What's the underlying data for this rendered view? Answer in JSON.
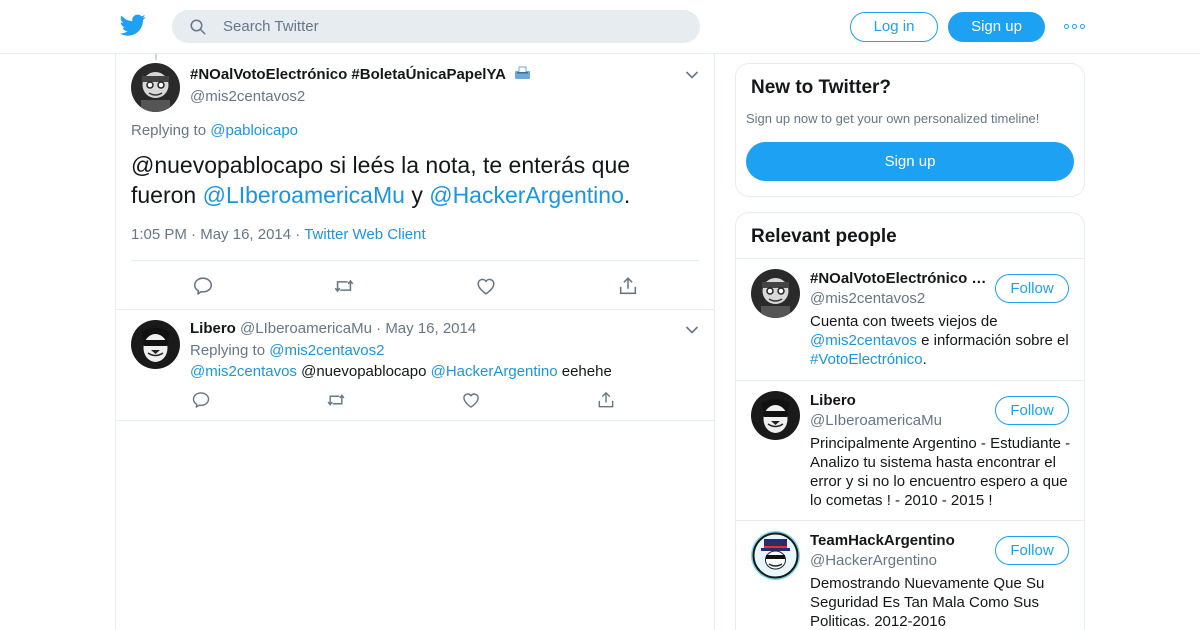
{
  "topbar": {
    "logo": "twitter-bird-icon",
    "search_placeholder": "Search Twitter",
    "login_label": "Log in",
    "signup_label": "Sign up",
    "more": "more-dots-icon"
  },
  "main_tweet": {
    "name": "#NOalVotoElectrónico #BoletaÚnicaPapelYA",
    "name_emoji": "ballot-box-icon",
    "handle": "@mis2centavos2",
    "replying_prefix": "Replying to",
    "replying_to": "@pabloicapo",
    "text_part1": "@nuevopablocapo si leés la nota, te enterás que fueron",
    "mention1": "@LIberoamericaMu",
    "text_part2": "y",
    "mention2": "@HackerArgentino",
    "text_end": ".",
    "time": "1:05 PM",
    "date": "May 16, 2014",
    "sep": "·",
    "client": "Twitter Web Client"
  },
  "reply_tweet": {
    "name": "Libero",
    "handle": "@LIberoamericaMu",
    "sep": "·",
    "date": "May 16, 2014",
    "replying_prefix": "Replying to",
    "replying_to": "@mis2centavos2",
    "mention_a": "@mis2centavos",
    "plain": "@nuevopablocapo",
    "mention_b": "@HackerArgentino",
    "tail": "eehehe"
  },
  "sidebar": {
    "new_title": "New to Twitter?",
    "new_sub": "Sign up now to get your own personalized timeline!",
    "new_signup": "Sign up",
    "relevant_title": "Relevant people",
    "follow_label": "Follow",
    "people": [
      {
        "name": "#NOalVotoElectrónico #...",
        "handle": "@mis2centavos2",
        "bio_a": "Cuenta con tweets viejos de",
        "bio_link1": "@mis2centavos",
        "bio_b": "e información sobre el",
        "bio_link2": "#VotoElectrónico",
        "bio_c": "."
      },
      {
        "name": "Libero",
        "handle": "@LIberoamericaMu",
        "bio": "Principalmente Argentino - Estudiante - Analizo tu sistema hasta encontrar el error y si no lo encuentro espero a que lo cometas ! - 2010 - 2015 !"
      },
      {
        "name": "TeamHackArgentino",
        "handle": "@HackerArgentino",
        "bio": "Demostrando Nuevamente Que Su Seguridad Es Tan Mala Como Sus Politicas. 2012-2016"
      }
    ]
  },
  "colors": {
    "brand": "#1da1f2",
    "link": "#1b95e0",
    "secondary_text": "#657786",
    "border": "#e6ecf0"
  }
}
